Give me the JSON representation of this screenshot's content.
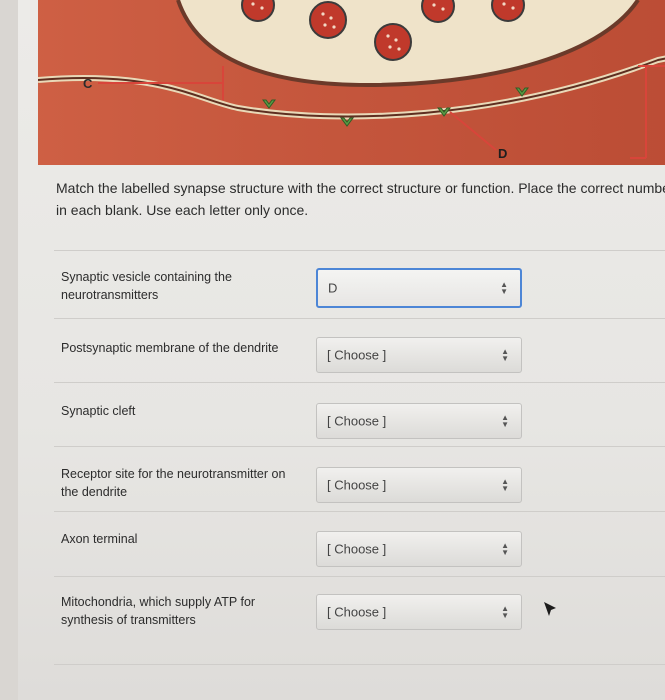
{
  "diagram": {
    "labels": {
      "c": "C",
      "d": "D"
    }
  },
  "prompt": "Match the labelled synapse structure with the correct structure or function. Place the correct number in each blank. Use each letter only once.",
  "rows": [
    {
      "label": "Synaptic vesicle containing the neurotransmitters",
      "value": "D"
    },
    {
      "label": "Postsynaptic membrane of the dendrite",
      "value": "[ Choose ]"
    },
    {
      "label": "Synaptic cleft",
      "value": "[ Choose ]"
    },
    {
      "label": "Receptor site for the neurotransmitter on the dendrite",
      "value": "[ Choose ]"
    },
    {
      "label": "Axon terminal",
      "value": "[ Choose ]"
    },
    {
      "label": "Mitochondria, which supply ATP for synthesis of transmitters",
      "value": "[ Choose ]"
    }
  ],
  "colors": {
    "focus_border": "#4d86d6",
    "diagram_bg": "#c9533a",
    "label_line": "#d8453a"
  }
}
